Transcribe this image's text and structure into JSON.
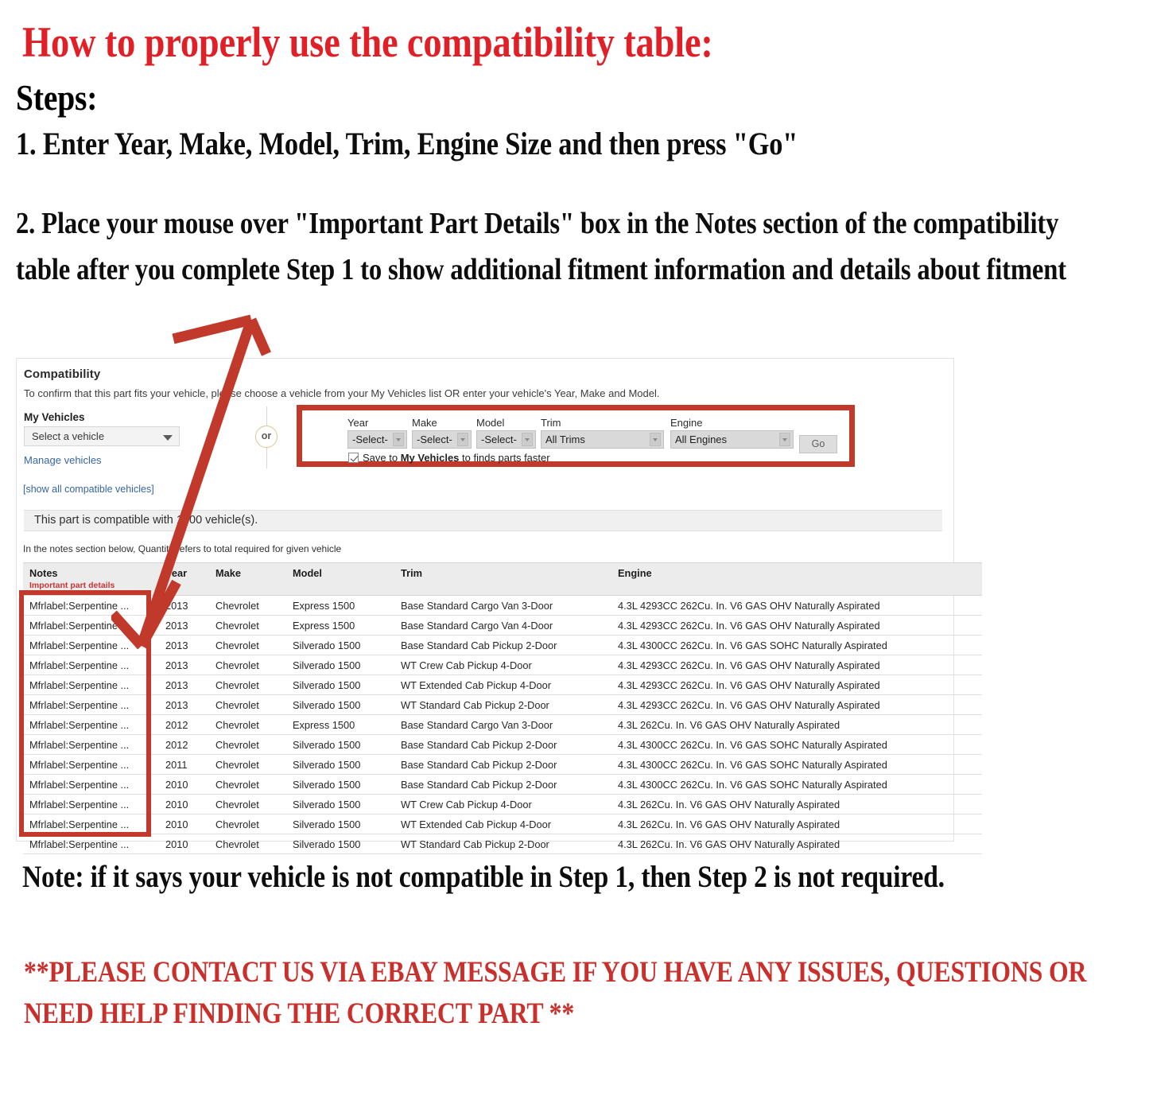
{
  "instructions": {
    "title": "How to properly use the compatibility table:",
    "steps_label": "Steps:",
    "step1": "1. Enter Year, Make, Model, Trim, Engine Size and then press \"Go\"",
    "step2": "2. Place your mouse over \"Important Part Details\" box in the Notes section of the compatibility table after you complete Step 1 to show additional fitment information and details about fitment",
    "note": "Note: if it says your vehicle is not compatible in Step 1, then Step 2 is not required.",
    "contact": "**PLEASE CONTACT US VIA EBAY MESSAGE IF YOU HAVE ANY ISSUES, QUESTIONS OR NEED HELP FINDING THE CORRECT PART **"
  },
  "colors": {
    "red_heading": "#e01f26",
    "red_contact": "#c9302c",
    "highlight_box": "#c0392b",
    "link_blue": "#3665a5",
    "notes_sub_red": "#cc3333"
  },
  "compatibility": {
    "title": "Compatibility",
    "subtitle": "To confirm that this part fits your vehicle, please choose a vehicle from your My Vehicles list OR enter your vehicle's Year, Make and Model.",
    "my_vehicles_label": "My Vehicles",
    "vehicle_select_value": "Select a vehicle",
    "manage_vehicles_link": "Manage vehicles",
    "show_all_link": "[show all compatible vehicles]",
    "or_label": "or",
    "banner": "This part is compatible with 1000 vehicle(s).",
    "qty_note": "In the notes section below, Quantity refers to total required for given vehicle",
    "form": {
      "year": {
        "label": "Year",
        "value": "-Select-"
      },
      "make": {
        "label": "Make",
        "value": "-Select-"
      },
      "model": {
        "label": "Model",
        "value": "-Select-"
      },
      "trim": {
        "label": "Trim",
        "value": "All Trims"
      },
      "engine": {
        "label": "Engine",
        "value": "All Engines"
      },
      "go_label": "Go",
      "save_prefix": "Save to ",
      "save_bold": "My Vehicles",
      "save_suffix": " to finds parts faster",
      "save_checked": true
    }
  },
  "table": {
    "headers": {
      "notes": "Notes",
      "notes_sub": "Important part details",
      "year": "Year",
      "make": "Make",
      "model": "Model",
      "trim": "Trim",
      "engine": "Engine"
    },
    "rows": [
      {
        "notes": "Mfrlabel:Serpentine ...",
        "year": "2013",
        "make": "Chevrolet",
        "model": "Express 1500",
        "trim": "Base Standard Cargo Van 3-Door",
        "engine": "4.3L 4293CC 262Cu. In. V6 GAS OHV Naturally Aspirated"
      },
      {
        "notes": "Mfrlabel:Serpentine ...",
        "year": "2013",
        "make": "Chevrolet",
        "model": "Express 1500",
        "trim": "Base Standard Cargo Van 4-Door",
        "engine": "4.3L 4293CC 262Cu. In. V6 GAS OHV Naturally Aspirated"
      },
      {
        "notes": "Mfrlabel:Serpentine ...",
        "year": "2013",
        "make": "Chevrolet",
        "model": "Silverado 1500",
        "trim": "Base Standard Cab Pickup 2-Door",
        "engine": "4.3L 4300CC 262Cu. In. V6 GAS SOHC Naturally Aspirated"
      },
      {
        "notes": "Mfrlabel:Serpentine ...",
        "year": "2013",
        "make": "Chevrolet",
        "model": "Silverado 1500",
        "trim": "WT Crew Cab Pickup 4-Door",
        "engine": "4.3L 4293CC 262Cu. In. V6 GAS OHV Naturally Aspirated"
      },
      {
        "notes": "Mfrlabel:Serpentine ...",
        "year": "2013",
        "make": "Chevrolet",
        "model": "Silverado 1500",
        "trim": "WT Extended Cab Pickup 4-Door",
        "engine": "4.3L 4293CC 262Cu. In. V6 GAS OHV Naturally Aspirated"
      },
      {
        "notes": "Mfrlabel:Serpentine ...",
        "year": "2013",
        "make": "Chevrolet",
        "model": "Silverado 1500",
        "trim": "WT Standard Cab Pickup 2-Door",
        "engine": "4.3L 4293CC 262Cu. In. V6 GAS OHV Naturally Aspirated"
      },
      {
        "notes": "Mfrlabel:Serpentine ...",
        "year": "2012",
        "make": "Chevrolet",
        "model": "Express 1500",
        "trim": "Base Standard Cargo Van 3-Door",
        "engine": "4.3L 262Cu. In. V6 GAS OHV Naturally Aspirated"
      },
      {
        "notes": "Mfrlabel:Serpentine ...",
        "year": "2012",
        "make": "Chevrolet",
        "model": "Silverado 1500",
        "trim": "Base Standard Cab Pickup 2-Door",
        "engine": "4.3L 4300CC 262Cu. In. V6 GAS SOHC Naturally Aspirated"
      },
      {
        "notes": "Mfrlabel:Serpentine ...",
        "year": "2011",
        "make": "Chevrolet",
        "model": "Silverado 1500",
        "trim": "Base Standard Cab Pickup 2-Door",
        "engine": "4.3L 4300CC 262Cu. In. V6 GAS SOHC Naturally Aspirated"
      },
      {
        "notes": "Mfrlabel:Serpentine ...",
        "year": "2010",
        "make": "Chevrolet",
        "model": "Silverado 1500",
        "trim": "Base Standard Cab Pickup 2-Door",
        "engine": "4.3L 4300CC 262Cu. In. V6 GAS SOHC Naturally Aspirated"
      },
      {
        "notes": "Mfrlabel:Serpentine ...",
        "year": "2010",
        "make": "Chevrolet",
        "model": "Silverado 1500",
        "trim": "WT Crew Cab Pickup 4-Door",
        "engine": "4.3L 262Cu. In. V6 GAS OHV Naturally Aspirated"
      },
      {
        "notes": "Mfrlabel:Serpentine ...",
        "year": "2010",
        "make": "Chevrolet",
        "model": "Silverado 1500",
        "trim": "WT Extended Cab Pickup 4-Door",
        "engine": "4.3L 262Cu. In. V6 GAS OHV Naturally Aspirated"
      },
      {
        "notes": "Mfrlabel:Serpentine ...",
        "year": "2010",
        "make": "Chevrolet",
        "model": "Silverado 1500",
        "trim": "WT Standard Cab Pickup 2-Door",
        "engine": "4.3L 262Cu. In. V6 GAS OHV Naturally Aspirated"
      }
    ]
  }
}
